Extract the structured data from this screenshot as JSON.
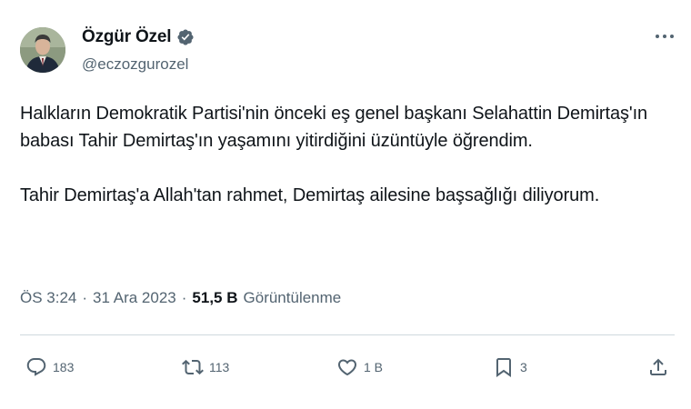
{
  "author": {
    "display_name": "Özgür Özel",
    "handle": "@eczozgurozel",
    "verified": true
  },
  "tweet": {
    "paragraphs": [
      "Halkların Demokratik Partisi'nin önceki eş genel başkanı Selahattin Demirtaş'ın babası Tahir Demirtaş'ın yaşamını yitirdiğini üzüntüyle öğrendim.",
      "Tahir Demirtaş'a Allah'tan rahmet, Demirtaş ailesine başsağlığı diliyorum."
    ]
  },
  "meta": {
    "time": "ÖS 3:24",
    "separator": "·",
    "date": "31 Ara 2023",
    "views_count": "51,5 B",
    "views_label": "Görüntülenme"
  },
  "actions": {
    "reply_count": "183",
    "retweet_count": "113",
    "like_count": "1 B",
    "bookmark_count": "3"
  },
  "colors": {
    "text_primary": "#0f1419",
    "text_secondary": "#536471",
    "verified_badge": "#536471",
    "divider": "#cfd9de"
  },
  "icons": {
    "more": "more-horizontal-icon",
    "verified": "verified-badge-icon",
    "reply": "reply-icon",
    "retweet": "retweet-icon",
    "like": "heart-icon",
    "bookmark": "bookmark-icon",
    "share": "share-icon"
  }
}
